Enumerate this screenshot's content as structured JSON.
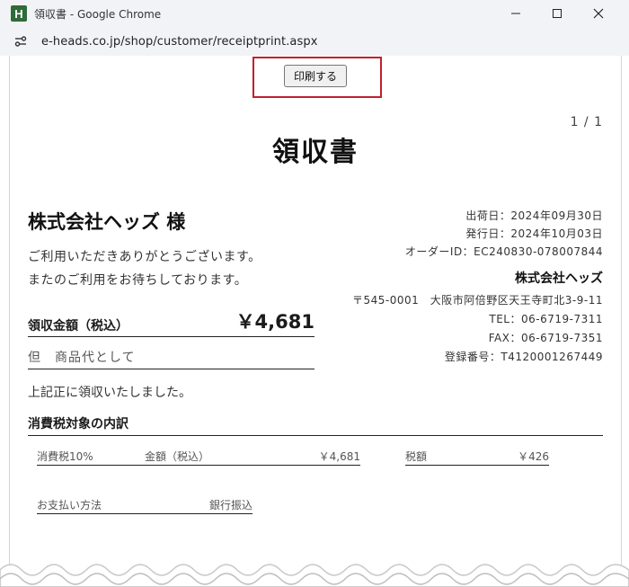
{
  "window": {
    "favicon_letter": "H",
    "title": "領収書 - Google Chrome",
    "url": "e-heads.co.jp/shop/customer/receiptprint.aspx"
  },
  "toolbar": {
    "print_label": "印刷する"
  },
  "page_count": "1 / 1",
  "doc_title": "領収書",
  "customer_name": "株式会社ヘッズ 様",
  "thanks_line1": "ご利用いただきありがとうございます。",
  "thanks_line2": "またのご利用をお待ちしております。",
  "total": {
    "label": "領収金額（税込）",
    "amount": "￥4,681"
  },
  "tadashi": "但　商品代として",
  "received_text": "上記正に領収いたしました。",
  "tax_section": {
    "heading": "消費税対象の内訳",
    "rate_label": "消費税10%",
    "amount_label": "金額（税込）",
    "amount_value": "￥4,681",
    "tax_label": "税額",
    "tax_value": "￥426"
  },
  "payment": {
    "label": "お支払い方法",
    "value": "銀行振込"
  },
  "issuer": {
    "ship_date": "出荷日：2024年09月30日",
    "issue_date": "発行日：2024年10月03日",
    "order_id": "オーダーID：EC240830-078007844",
    "company": "株式会社ヘッズ",
    "address": "〒545-0001　大阪市阿倍野区天王寺町北3-9-11",
    "tel": "TEL：06-6719-7311",
    "fax": "FAX：06-6719-7351",
    "registration": "登録番号：T4120001267449"
  },
  "colors": {
    "highlight": "#c2202f",
    "favicon_bg": "#2f6b3a",
    "chrome_bg": "#f1f3f7"
  },
  "icons": [
    "minimize-icon",
    "maximize-icon",
    "close-icon",
    "site-info-icon"
  ]
}
